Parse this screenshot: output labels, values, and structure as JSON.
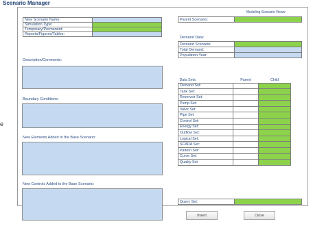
{
  "window": {
    "title": "Scenario Manager",
    "left_edge_char": "e"
  },
  "colors": {
    "input_blue": "#c5d9f1",
    "input_green": "#8cd34b",
    "label_text": "#2b4f84"
  },
  "top_left_rows": [
    {
      "label": "New Scenario Name:",
      "fill": "blue"
    },
    {
      "label": "Simulation Type:",
      "fill": "green"
    },
    {
      "label": "Temporary/Permanent:",
      "fill": "green"
    },
    {
      "label": "Reports/Figures/Tables:",
      "fill": "blue"
    }
  ],
  "sections": {
    "description": "Description/Comments:",
    "boundary": "Boundary Conditions:",
    "new_elements": "New Elements Added to the Base Scenario:",
    "new_controls": "New Controls Added to the Base Scenario:"
  },
  "right_top": {
    "modeling_caption": "Modeling Scenario Views:",
    "parent_label": "Parent Scenario:"
  },
  "demand": {
    "heading": "Demand Data:",
    "rows": [
      {
        "label": "Demand Scenario:",
        "fill": "green"
      },
      {
        "label": "Total Demand:",
        "fill": "blue"
      },
      {
        "label": "Population Year:",
        "fill": "blue"
      }
    ]
  },
  "data_sets": {
    "heading": "Data Sets:",
    "col_parent": "Parent",
    "col_child": "Child",
    "rows": [
      "Demand Set:",
      "Tank Set:",
      "Reservoir Set:",
      "Pump Set:",
      "Valve Set:",
      "Pipe Set:",
      "Control Set:",
      "Energy Set:",
      "Outflow Set:",
      "Logical Set:",
      "SCADA Set:",
      "Pattern Set:",
      "Curve Set:",
      "Quality Set:"
    ]
  },
  "query": {
    "label": "Query Set:"
  },
  "buttons": {
    "insert": "Insert",
    "close": "Close"
  }
}
